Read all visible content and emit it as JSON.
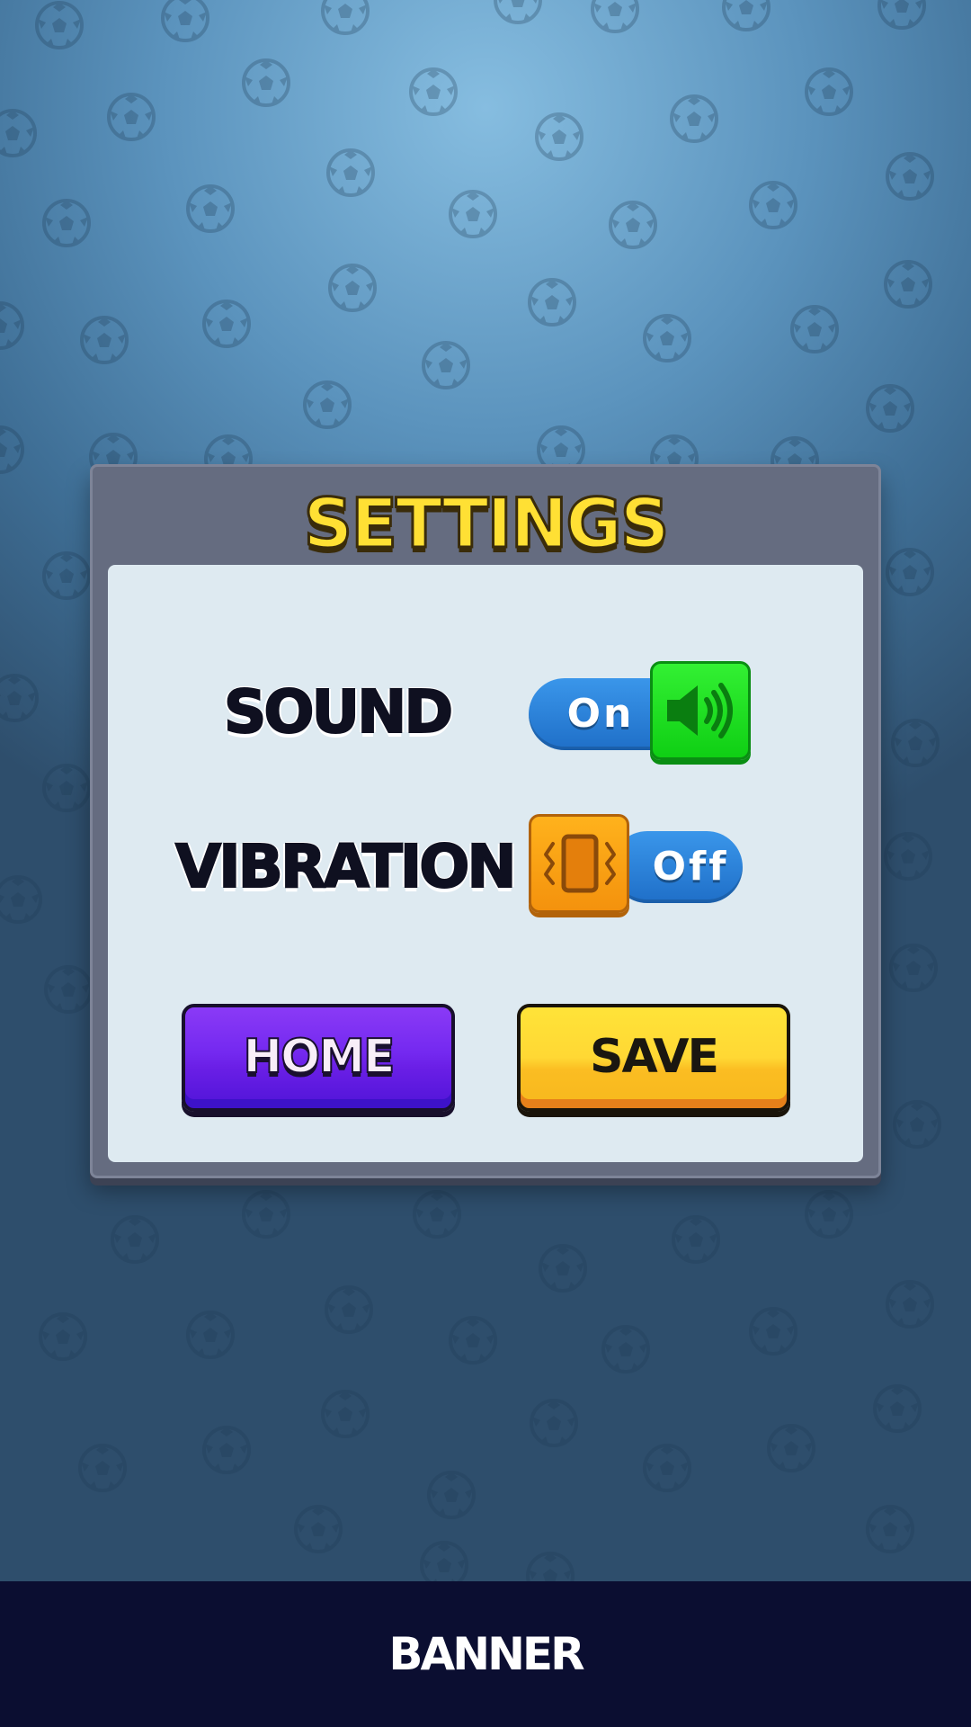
{
  "title": "SETTINGS",
  "settings": {
    "sound": {
      "label": "SOUND",
      "state_text": "On",
      "icon": "speaker-icon",
      "is_on": true
    },
    "vibration": {
      "label": "VIBRATION",
      "state_text": "Off",
      "icon": "phone-vibration-icon",
      "is_on": false
    }
  },
  "buttons": {
    "home": "HOME",
    "save": "SAVE"
  },
  "banner": {
    "text": "BANNER"
  },
  "colors": {
    "title": "#ffe034",
    "panel": "#656c80",
    "panel_inner": "#deeaf1",
    "toggle_track": "#2a84dc",
    "sound_knob": "#1fe01f",
    "vibration_knob": "#f8a015",
    "home_button": "#7429f0",
    "save_button": "#ffd834",
    "banner": "#0b0e31"
  },
  "background_icon": "soccer-ball-icon"
}
